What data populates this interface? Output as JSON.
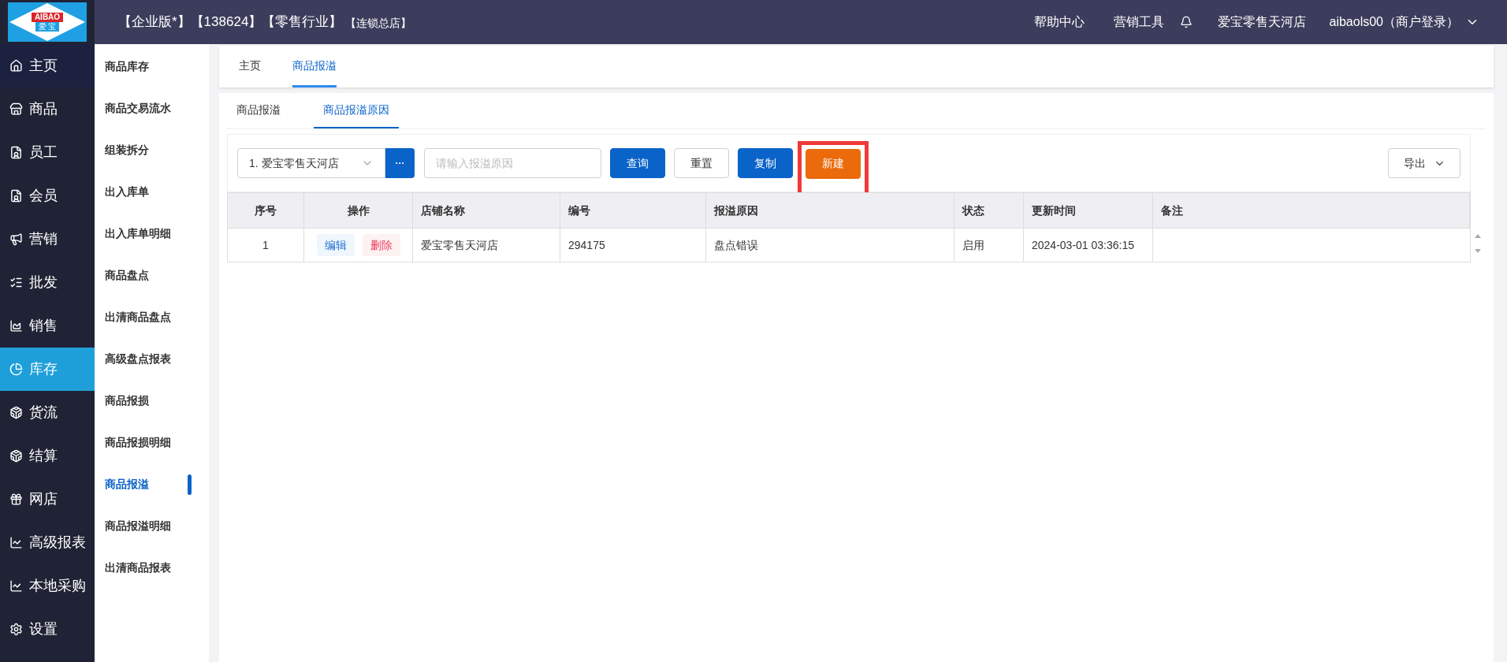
{
  "header": {
    "logo_text": "AIBAO",
    "logo_subtext": "爱 宝",
    "edition": "【企业版*】【138624】【零售行业】",
    "branch": "【连锁总店】",
    "links": [
      "帮助中心",
      "营销工具"
    ],
    "store": "爱宝零售天河店",
    "user": "aibaols00（商户登录）"
  },
  "sidebar": {
    "items": [
      {
        "label": "主页",
        "selected": false
      },
      {
        "label": "商品",
        "selected": false
      },
      {
        "label": "员工",
        "selected": false
      },
      {
        "label": "会员",
        "selected": false
      },
      {
        "label": "营销",
        "selected": false
      },
      {
        "label": "批发",
        "selected": false
      },
      {
        "label": "销售",
        "selected": false
      },
      {
        "label": "库存",
        "selected": true
      },
      {
        "label": "货流",
        "selected": false
      },
      {
        "label": "结算",
        "selected": false
      },
      {
        "label": "网店",
        "selected": false
      },
      {
        "label": "高级报表",
        "selected": false
      },
      {
        "label": "本地采购",
        "selected": false
      },
      {
        "label": "设置",
        "selected": false
      }
    ]
  },
  "submenu": {
    "items": [
      {
        "label": "商品库存",
        "selected": false
      },
      {
        "label": "商品交易流水",
        "selected": false
      },
      {
        "label": "组装拆分",
        "selected": false
      },
      {
        "label": "出入库单",
        "selected": false
      },
      {
        "label": "出入库单明细",
        "selected": false
      },
      {
        "label": "商品盘点",
        "selected": false
      },
      {
        "label": "出清商品盘点",
        "selected": false
      },
      {
        "label": "高级盘点报表",
        "selected": false
      },
      {
        "label": "商品报损",
        "selected": false
      },
      {
        "label": "商品报损明细",
        "selected": false
      },
      {
        "label": "商品报溢",
        "selected": true
      },
      {
        "label": "商品报溢明细",
        "selected": false
      },
      {
        "label": "出清商品报表",
        "selected": false
      }
    ]
  },
  "page_tabs": [
    {
      "label": "主页",
      "selected": false
    },
    {
      "label": "商品报溢",
      "selected": true
    }
  ],
  "sub_tabs": [
    {
      "label": "商品报溢",
      "selected": false
    },
    {
      "label": "商品报溢原因",
      "selected": true
    }
  ],
  "toolbar": {
    "store_select": "1. 爱宝零售天河店",
    "more_button": "···",
    "search": {
      "placeholder": "请输入报溢原因"
    },
    "buttons": [
      {
        "label": "查询",
        "kind": "primary",
        "highlighted": false
      },
      {
        "label": "重置",
        "kind": "default",
        "highlighted": false
      },
      {
        "label": "复制",
        "kind": "primary",
        "highlighted": false
      },
      {
        "label": "新建",
        "kind": "warning",
        "highlighted": true
      }
    ],
    "export": "导出"
  },
  "table": {
    "columns": [
      "序号",
      "操作",
      "店铺名称",
      "编号",
      "报溢原因",
      "状态",
      "更新时间",
      "备注"
    ],
    "rows": [
      {
        "index": "1",
        "actions": [
          "编辑",
          "删除"
        ],
        "store": "爱宝零售天河店",
        "code": "294175",
        "reason": "盘点错误",
        "status": "启用",
        "updated": "2024-03-01 03:36:15"
      }
    ]
  }
}
